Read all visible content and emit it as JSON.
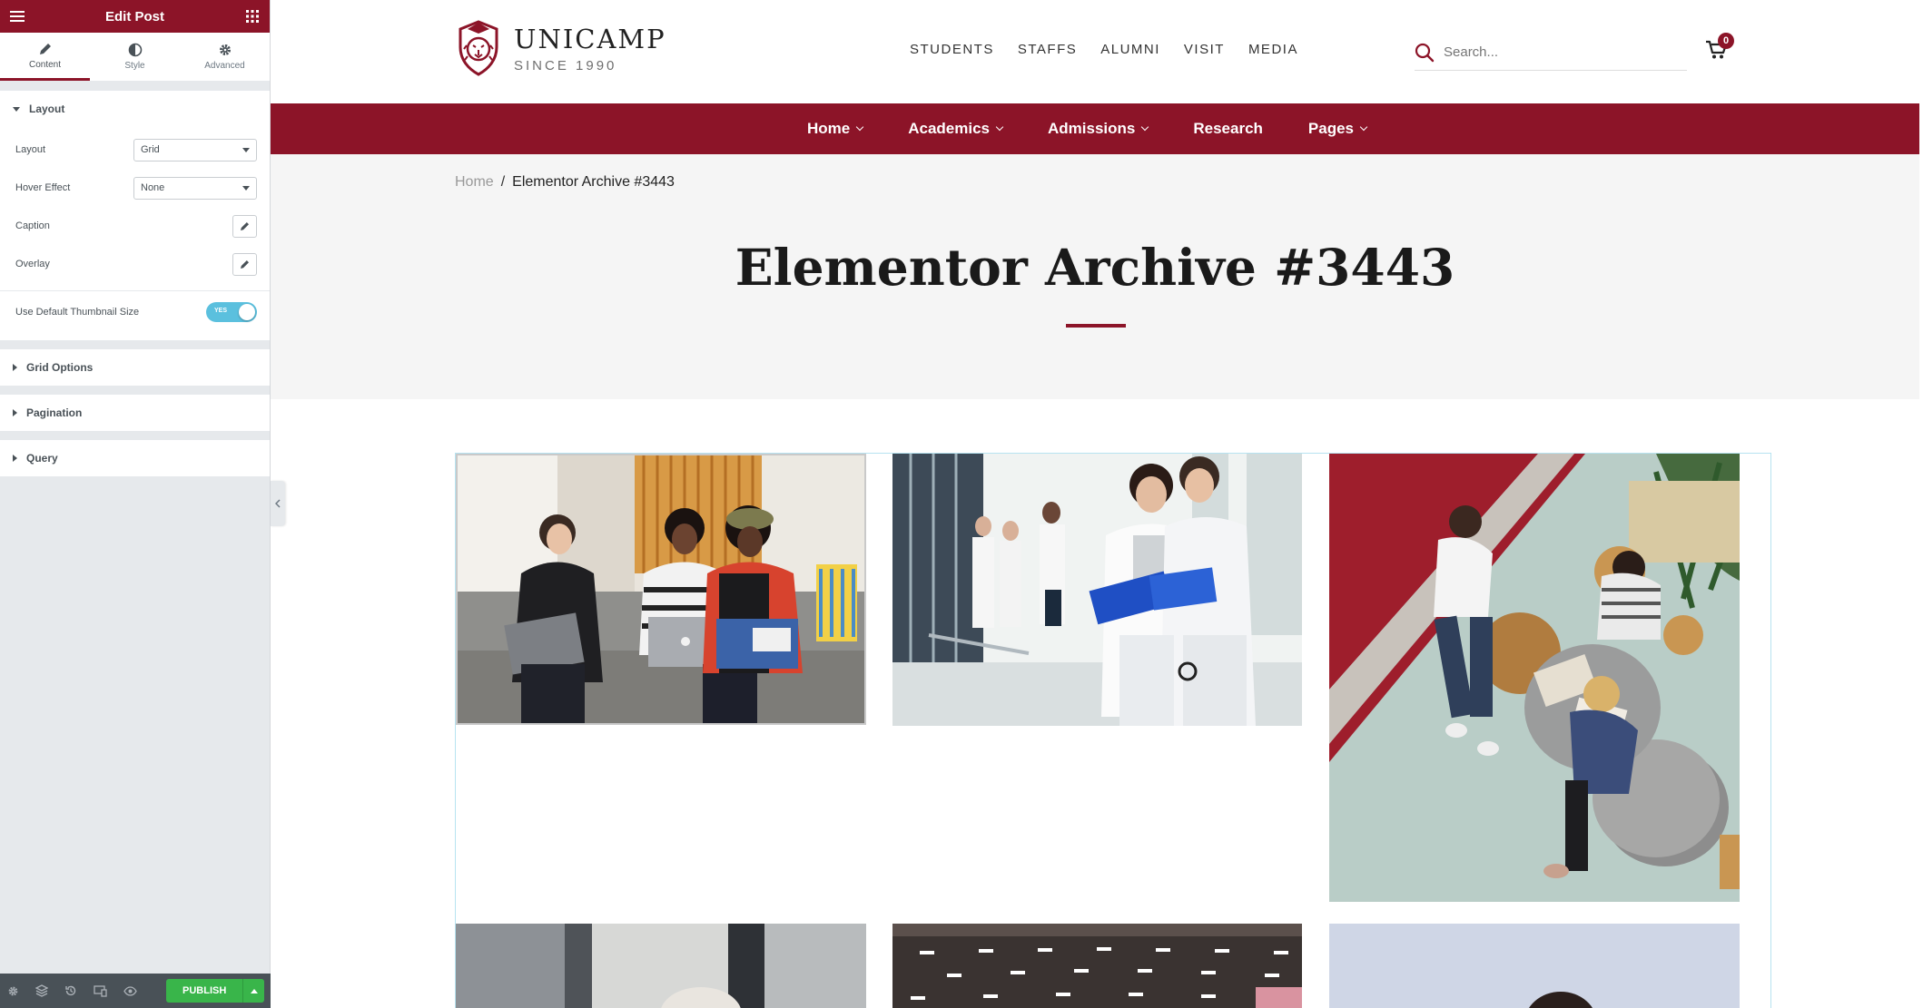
{
  "panel": {
    "title": "Edit Post",
    "tabs": [
      {
        "label": "Content",
        "icon": "pencil-icon"
      },
      {
        "label": "Style",
        "icon": "half-circle-icon"
      },
      {
        "label": "Advanced",
        "icon": "gear-icon"
      }
    ],
    "sections": {
      "layout": {
        "title": "Layout",
        "layout_label": "Layout",
        "layout_value": "Grid",
        "hover_label": "Hover Effect",
        "hover_value": "None",
        "caption_label": "Caption",
        "overlay_label": "Overlay",
        "thumb_label": "Use Default Thumbnail Size",
        "thumb_toggle": "YES"
      },
      "grid_options": "Grid Options",
      "pagination": "Pagination",
      "query": "Query"
    },
    "footer": {
      "publish_label": "PUBLISH"
    }
  },
  "site": {
    "logo": {
      "name": "UNICAMP",
      "since": "SINCE 1990"
    },
    "top_nav": [
      "STUDENTS",
      "STAFFS",
      "ALUMNI",
      "VISIT",
      "MEDIA"
    ],
    "search_placeholder": "Search...",
    "cart_count": "0",
    "main_nav": [
      {
        "label": "Home",
        "dropdown": true
      },
      {
        "label": "Academics",
        "dropdown": true
      },
      {
        "label": "Admissions",
        "dropdown": true
      },
      {
        "label": "Research",
        "dropdown": false
      },
      {
        "label": "Pages",
        "dropdown": true
      }
    ],
    "breadcrumb": {
      "home": "Home",
      "separator": "/",
      "current": "Elementor Archive #3443"
    },
    "page_title": "Elementor Archive #3443",
    "colors": {
      "brand": "#8c1428",
      "publish": "#39b54a",
      "toggle": "#5bc0de"
    }
  }
}
